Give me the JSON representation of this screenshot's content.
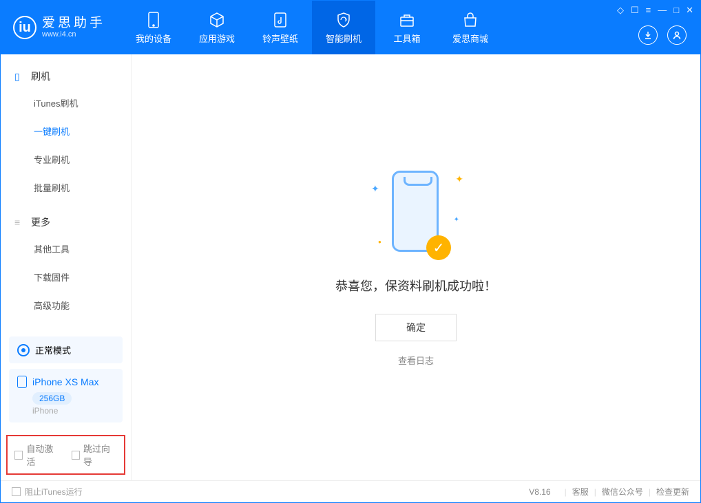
{
  "app": {
    "title": "爱思助手",
    "subtitle": "www.i4.cn"
  },
  "tabs": [
    {
      "label": "我的设备"
    },
    {
      "label": "应用游戏"
    },
    {
      "label": "铃声壁纸"
    },
    {
      "label": "智能刷机"
    },
    {
      "label": "工具箱"
    },
    {
      "label": "爱思商城"
    }
  ],
  "sidebar": {
    "group1_title": "刷机",
    "group1_items": [
      "iTunes刷机",
      "一键刷机",
      "专业刷机",
      "批量刷机"
    ],
    "group2_title": "更多",
    "group2_items": [
      "其他工具",
      "下载固件",
      "高级功能"
    ]
  },
  "mode_label": "正常模式",
  "device": {
    "name": "iPhone XS Max",
    "capacity": "256GB",
    "type": "iPhone"
  },
  "options": {
    "auto_activate": "自动激活",
    "skip_guide": "跳过向导"
  },
  "main": {
    "success_text": "恭喜您，保资料刷机成功啦！",
    "ok_button": "确定",
    "log_link": "查看日志"
  },
  "footer": {
    "block_itunes": "阻止iTunes运行",
    "version": "V8.16",
    "links": [
      "客服",
      "微信公众号",
      "检查更新"
    ]
  }
}
